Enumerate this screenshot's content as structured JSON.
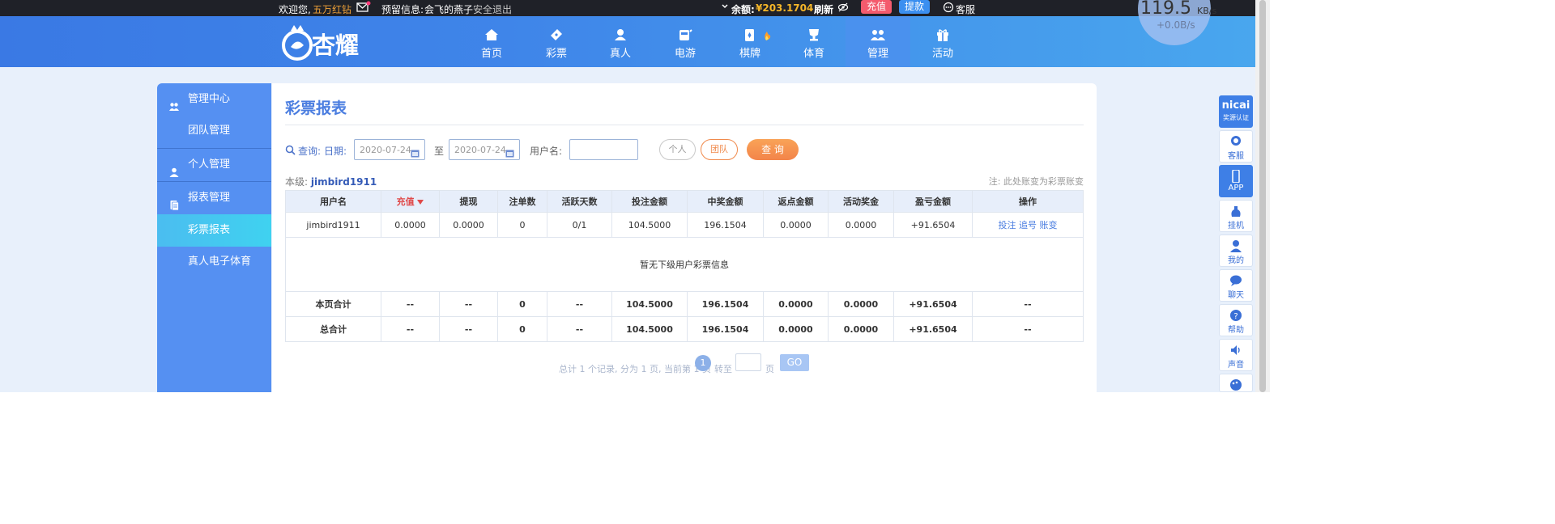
{
  "topbar": {
    "welcome": "欢迎您,",
    "username": "五万红钻",
    "reserved_label": "预留信息:",
    "reserved_value": "会飞的燕子",
    "logout": "安全退出",
    "balance_label": "余额:",
    "balance_value": "¥203.1704",
    "refresh": "刷新",
    "deposit": "充值",
    "withdraw": "提款",
    "service": "客服"
  },
  "brand": {
    "logo_text": "杏耀"
  },
  "nav": {
    "items": [
      {
        "label": "首页",
        "icon": "home-icon"
      },
      {
        "label": "彩票",
        "icon": "ticket-icon"
      },
      {
        "label": "真人",
        "icon": "dealer-icon"
      },
      {
        "label": "电游",
        "icon": "slot-icon"
      },
      {
        "label": "棋牌",
        "icon": "cards-icon"
      },
      {
        "label": "体育",
        "icon": "trophy-icon"
      },
      {
        "label": "管理",
        "icon": "users-icon"
      },
      {
        "label": "活动",
        "icon": "gift-icon"
      }
    ],
    "active": "管理"
  },
  "sidebar": {
    "items": [
      {
        "label": "管理中心",
        "icon": "users-icon"
      },
      {
        "label": "团队管理"
      },
      {
        "label": "个人管理",
        "icon": "user-icon"
      },
      {
        "label": "报表管理",
        "icon": "report-icon"
      },
      {
        "label": "彩票报表"
      },
      {
        "label": "真人电子体育"
      }
    ],
    "active": "彩票报表"
  },
  "main": {
    "title": "彩票报表",
    "query_label": "查询:",
    "date_label": "日期:",
    "date_from": "2020-07-24",
    "to_label": "至",
    "date_to": "2020-07-24",
    "username_label": "用户名:",
    "username_value": "",
    "btn_personal": "个人",
    "btn_team": "团队",
    "btn_query": "查 询",
    "level_label": "本级:",
    "level_user": "jimbird1911",
    "note": "注: 此处账变为彩票账变"
  },
  "table": {
    "headers": [
      "用户名",
      "充值",
      "提现",
      "注单数",
      "活跃天数",
      "投注金额",
      "中奖金额",
      "返点金额",
      "活动奖金",
      "盈亏金额",
      "操作"
    ],
    "row": {
      "user": "jimbird1911",
      "cells": [
        "0.0000",
        "0.0000",
        "0",
        "0/1",
        "104.5000",
        "196.1504",
        "0.0000",
        "0.0000"
      ],
      "profit": "+91.6504",
      "actions": [
        "投注",
        "追号",
        "账变"
      ]
    },
    "empty_text": "暂无下级用户彩票信息",
    "page_total": {
      "label": "本页合计",
      "cells": [
        "--",
        "--",
        "0",
        "--",
        "104.5000",
        "196.1504",
        "0.0000",
        "0.0000",
        "+91.6504",
        "--"
      ]
    },
    "grand_total": {
      "label": "总合计",
      "cells": [
        "--",
        "--",
        "0",
        "--",
        "104.5000",
        "196.1504",
        "0.0000",
        "0.0000",
        "+91.6504",
        "--"
      ]
    }
  },
  "pagination": {
    "summary": "总计 1 个记录, 分为 1 页, 当前第 1 页",
    "current": "1",
    "goto": "转至",
    "page": "页",
    "go": "GO"
  },
  "rail": {
    "items": [
      {
        "label": "奖源认证",
        "icon": "nicai-icon",
        "badge": "nicai"
      },
      {
        "label": "客服",
        "icon": "service-icon"
      },
      {
        "label": "APP",
        "icon": "phone-icon"
      },
      {
        "label": "挂机",
        "icon": "bag-icon"
      },
      {
        "label": "我的",
        "icon": "profile-icon"
      },
      {
        "label": "聊天",
        "icon": "chat-icon"
      },
      {
        "label": "帮助",
        "icon": "help-icon"
      },
      {
        "label": "声音",
        "icon": "sound-icon"
      },
      {
        "label": "",
        "icon": "palette-icon"
      }
    ]
  },
  "speed": {
    "value": "119.5",
    "unit": "KB/s",
    "sub": "+0.0B/s"
  }
}
